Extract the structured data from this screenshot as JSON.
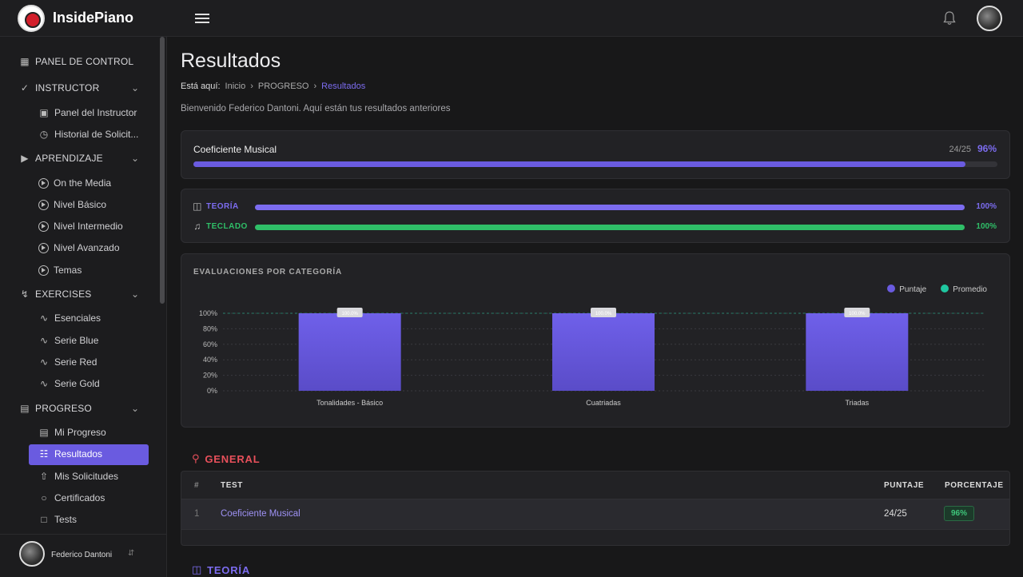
{
  "app": {
    "brand": "InsidePiano"
  },
  "sidebar": {
    "sections": [
      {
        "label": "PANEL DE CONTROL",
        "icon": "grid-icon"
      },
      {
        "label": "INSTRUCTOR",
        "icon": "check-circle-icon",
        "items": [
          "Panel del Instructor",
          "Historial de Solicit..."
        ]
      },
      {
        "label": "APRENDIZAJE",
        "icon": "video-icon",
        "items": [
          "On the Media",
          "Nivel Básico",
          "Nivel Intermedio",
          "Nivel Avanzado",
          "Temas"
        ]
      },
      {
        "label": "EXERCISES",
        "icon": "bolt-icon",
        "items": [
          "Esenciales",
          "Serie Blue",
          "Serie Red",
          "Serie Gold"
        ]
      },
      {
        "label": "PROGRESO",
        "icon": "bar-chart-icon",
        "items": [
          "Mi Progreso",
          "Resultados",
          "Mis Solicitudes",
          "Certificados",
          "Tests"
        ]
      }
    ],
    "active_item": "Resultados",
    "user": {
      "name": "Federico Dantoni"
    }
  },
  "page": {
    "title": "Resultados",
    "breadcrumb": {
      "label": "Está aquí:",
      "items": [
        "Inicio",
        "PROGRESO",
        "Resultados"
      ]
    },
    "welcome": "Bienvenido Federico Dantoni. Aquí están tus resultados anteriores"
  },
  "coeficiente": {
    "label": "Coeficiente Musical",
    "score": "24/25",
    "percent": "96%",
    "fill": 0.96,
    "color": "#6a5be0"
  },
  "categories": [
    {
      "label": "TEORÍA",
      "percent": "100%",
      "fill": 1.0,
      "color": "#7c6cf0"
    },
    {
      "label": "TECLADO",
      "percent": "100%",
      "fill": 1.0,
      "color": "#2fbf68"
    }
  ],
  "chart_data": {
    "type": "bar",
    "title": "EVALUACIONES POR CATEGORÍA",
    "categories": [
      "Tonalidades - Básico",
      "Cuatriadas",
      "Triadas"
    ],
    "series": [
      {
        "name": "Puntaje",
        "values": [
          100,
          100,
          100
        ],
        "color": "#6a5be0"
      },
      {
        "name": "Promedio",
        "values": [
          100,
          100,
          100
        ],
        "color": "#1fc7a0"
      }
    ],
    "data_labels": [
      "100.0%",
      "100.0%",
      "100.0%"
    ],
    "yticks": [
      "100%",
      "80%",
      "60%",
      "40%",
      "20%",
      "0%"
    ],
    "ylim": [
      0,
      100
    ],
    "legend": "top-right"
  },
  "general": {
    "heading": "GENERAL",
    "columns": [
      "#",
      "TEST",
      "PUNTAJE",
      "PORCENTAJE"
    ],
    "rows": [
      {
        "n": "1",
        "test": "Coeficiente Musical",
        "score": "24/25",
        "percent": "96%"
      }
    ]
  },
  "next_section": {
    "heading": "TEORÍA"
  }
}
